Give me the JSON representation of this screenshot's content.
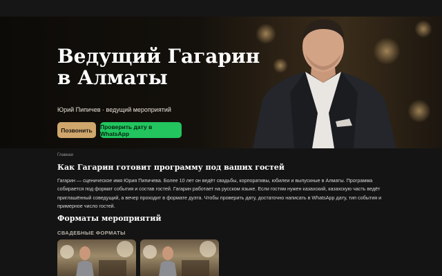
{
  "hero": {
    "title": "Ведущий Гагарин в Алматы",
    "subtitle": "Юрий Пипичев · ведущий мероприятий",
    "call_button": "Позвонить",
    "whatsapp_button": "Проверить дату в WhatsApp"
  },
  "breadcrumb": "Главная",
  "section1": {
    "heading": "Как Гагарин готовит программу под ваших гостей",
    "text": "Гагарин — сценическое имя Юрия Пипичева. Более 10 лет он ведёт свадьбы, корпоративы, юбилеи и выпускные в Алматы. Программа собирается под формат события и состав гостей. Гагарин работает на русском языке. Если гостям нужен казахский, казахскую часть ведёт приглашённый соведущий, а вечер проходит в формате дуэта. Чтобы проверить дату, достаточно написать в WhatsApp дату, тип события и примерное число гостей."
  },
  "section2": {
    "heading": "Форматы мероприятий",
    "subheading": "СВАДЕБНЫЕ ФОРМАТЫ"
  },
  "colors": {
    "call": "#cfa66c",
    "whatsapp": "#22c55e",
    "background": "#141414"
  }
}
